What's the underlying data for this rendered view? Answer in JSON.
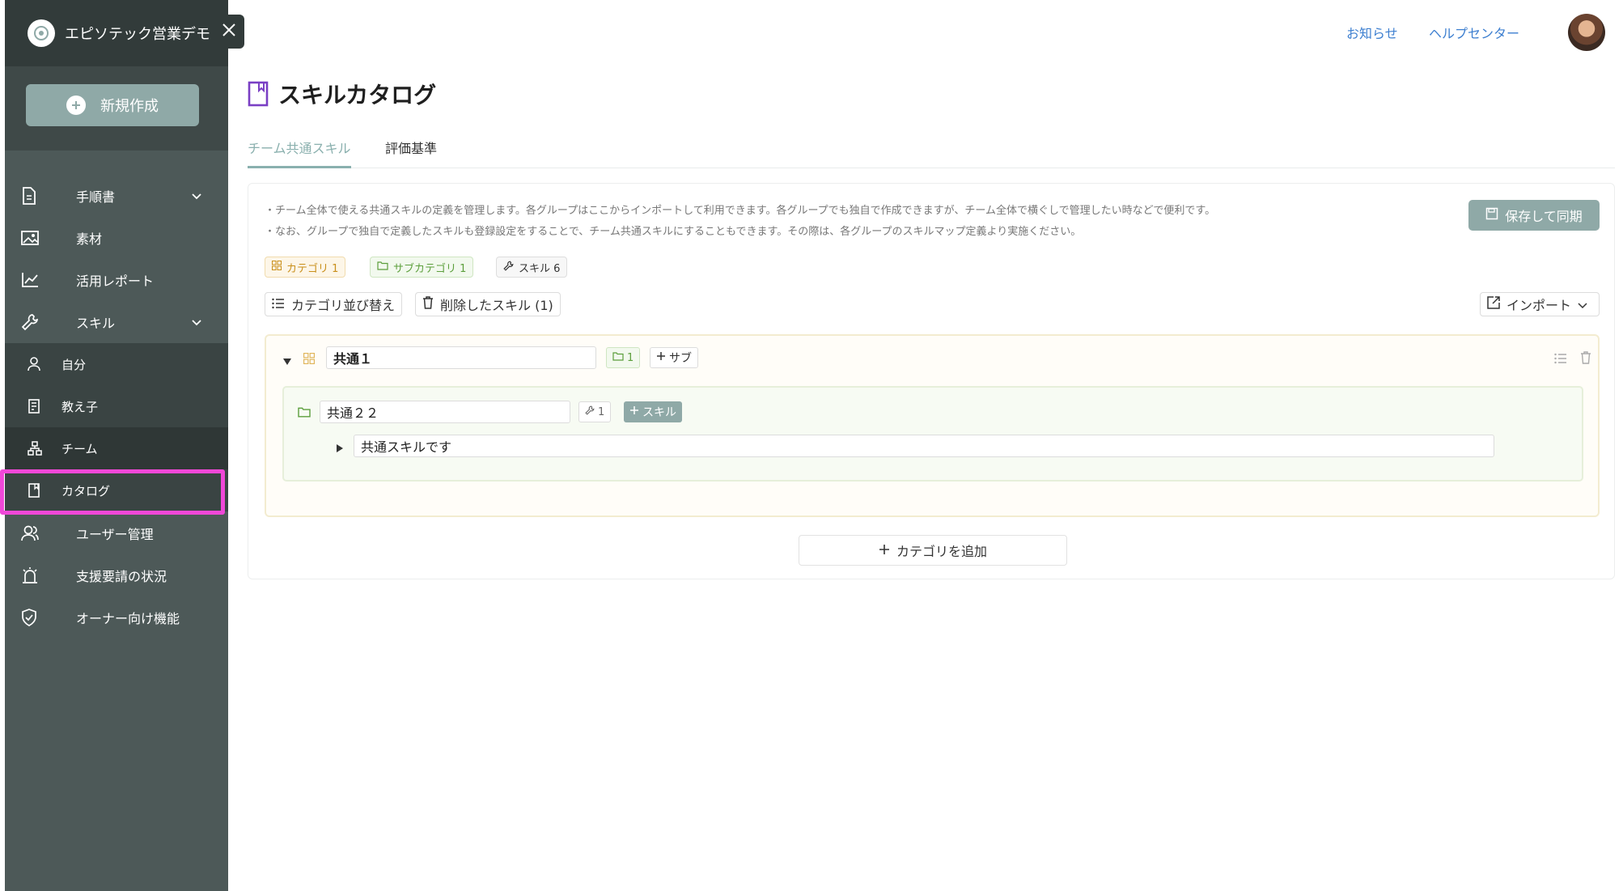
{
  "sidebar": {
    "org_name": "エピソテック営業デモ",
    "new_button": "新規作成",
    "items": [
      {
        "label": "手順書",
        "icon": "document-icon"
      },
      {
        "label": "素材",
        "icon": "image-icon"
      },
      {
        "label": "活用レポート",
        "icon": "chart-icon"
      },
      {
        "label": "スキル",
        "icon": "wrench-icon"
      },
      {
        "label": "ユーザー管理",
        "icon": "users-icon"
      },
      {
        "label": "支援要請の状況",
        "icon": "alarm-icon"
      },
      {
        "label": "オーナー向け機能",
        "icon": "shield-icon"
      }
    ],
    "skill_sub_items": [
      {
        "label": "自分",
        "icon": "person-icon"
      },
      {
        "label": "教え子",
        "icon": "notebook-icon"
      },
      {
        "label": "チーム",
        "icon": "team-icon"
      },
      {
        "label": "カタログ",
        "icon": "bookmark-icon"
      }
    ]
  },
  "header": {
    "links": [
      "お知らせ",
      "ヘルプセンター"
    ]
  },
  "main": {
    "title": "スキルカタログ",
    "tabs": [
      "チーム共通スキル",
      "評価基準"
    ],
    "descriptions": [
      "・チーム全体で使える共通スキルの定義を管理します。各グループはここからインポートして利用できます。各グループでも独自で作成できますが、チーム全体で横ぐしで管理したい時などで便利です。",
      "・なお、グループで独自で定義したスキルも登録設定をすることで、チーム共通スキルにすることもできます。その際は、各グループのスキルマップ定義より実施ください。"
    ],
    "save_button": "保存して同期",
    "chips": {
      "category": "カテゴリ 1",
      "subcategory": "サブカテゴリ 1",
      "skill": "スキル 6"
    },
    "toolbar": {
      "reorder": "カテゴリ並び替え",
      "deleted": "削除したスキル (1)",
      "import": "インポート"
    },
    "category": {
      "name": "共通１",
      "sub_count": "1",
      "add_sub": "サブ",
      "subcategory": {
        "name": "共通２２",
        "skill_count": "1",
        "add_skill": "スキル",
        "skill": "共通スキルです"
      }
    },
    "add_category": "カテゴリを追加"
  },
  "colors": {
    "sidebar_bg": "#4d5958",
    "accent": "#8fa9a7",
    "link": "#3d7fd0",
    "highlight": "#f048d8"
  }
}
